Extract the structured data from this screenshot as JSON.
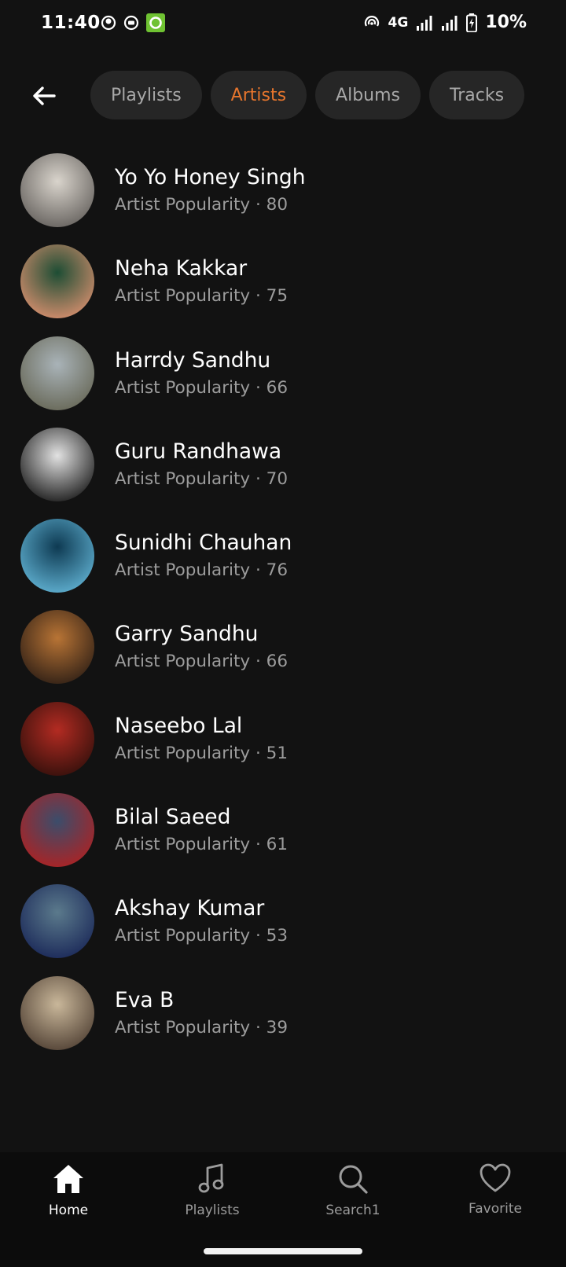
{
  "status_bar": {
    "time": "11:40",
    "network": "4G",
    "battery": "10%"
  },
  "filters": {
    "chips": [
      {
        "label": "Playlists",
        "active": false
      },
      {
        "label": "Artists",
        "active": true
      },
      {
        "label": "Albums",
        "active": false
      },
      {
        "label": "Tracks",
        "active": false
      }
    ],
    "active_color": "#e6752d"
  },
  "artists": [
    {
      "name": "Yo Yo Honey Singh",
      "subtitle": "Artist Popularity · 80",
      "popularity": 80,
      "avatar_colors": [
        "#d9d4cc",
        "#6e6a66"
      ]
    },
    {
      "name": "Neha Kakkar",
      "subtitle": "Artist Popularity · 75",
      "popularity": 75,
      "avatar_colors": [
        "#1d4d34",
        "#c98a6a"
      ]
    },
    {
      "name": "Harrdy Sandhu",
      "subtitle": "Artist Popularity · 66",
      "popularity": 66,
      "avatar_colors": [
        "#a9b3b8",
        "#6c6d5e"
      ]
    },
    {
      "name": "Guru Randhawa",
      "subtitle": "Artist Popularity · 70",
      "popularity": 70,
      "avatar_colors": [
        "#e2e2e2",
        "#2a2a2a"
      ]
    },
    {
      "name": "Sunidhi Chauhan",
      "subtitle": "Artist Popularity · 76",
      "popularity": 76,
      "avatar_colors": [
        "#0e3a52",
        "#5aa8c8"
      ]
    },
    {
      "name": "Garry Sandhu",
      "subtitle": "Artist Popularity · 66",
      "popularity": 66,
      "avatar_colors": [
        "#b87435",
        "#3a2618"
      ]
    },
    {
      "name": "Naseebo Lal",
      "subtitle": "Artist Popularity · 51",
      "popularity": 51,
      "avatar_colors": [
        "#b32b22",
        "#3d120d"
      ]
    },
    {
      "name": "Bilal Saeed",
      "subtitle": "Artist Popularity · 61",
      "popularity": 61,
      "avatar_colors": [
        "#3b4d6b",
        "#a52528"
      ]
    },
    {
      "name": "Akshay Kumar",
      "subtitle": "Artist Popularity · 53",
      "popularity": 53,
      "avatar_colors": [
        "#5b7a8c",
        "#1f2e5c"
      ]
    },
    {
      "name": "Eva B",
      "subtitle": "Artist Popularity · 39",
      "popularity": 39,
      "avatar_colors": [
        "#c9b79a",
        "#5a4a3c"
      ]
    }
  ],
  "bottom_nav": {
    "items": [
      {
        "label": "Home",
        "icon": "home-icon",
        "active": true
      },
      {
        "label": "Playlists",
        "icon": "music-note-icon",
        "active": false
      },
      {
        "label": "Search1",
        "icon": "search-icon",
        "active": false
      },
      {
        "label": "Favorite",
        "icon": "heart-icon",
        "active": false
      }
    ]
  }
}
